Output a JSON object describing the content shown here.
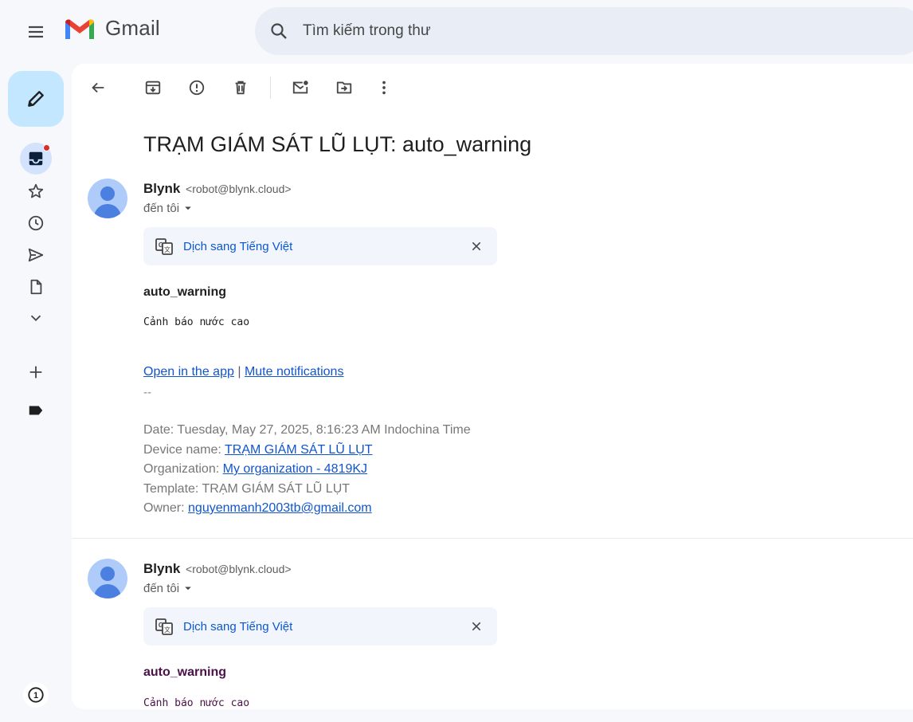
{
  "app": {
    "name": "Gmail"
  },
  "search": {
    "placeholder": "Tìm kiếm trong thư"
  },
  "toolbar": {
    "back": "arrow-back-icon",
    "archive": "archive-icon",
    "spam": "report-spam-icon",
    "delete": "delete-icon",
    "mark_unread": "mark-unread-icon",
    "move": "move-to-icon",
    "more": "more-vert-icon"
  },
  "subject": "TRẠM GIÁM SÁT LŨ LỤT: auto_warning",
  "colors": {
    "accent": "#0b57d0",
    "compose_bg": "#c2e7ff",
    "unread_dot": "#d93025",
    "link": "#1155cc",
    "visited": "#4a1248"
  },
  "messages": [
    {
      "sender_name": "Blynk",
      "sender_email": "<robot@blynk.cloud>",
      "to": "đến tôi",
      "translate_label": "Dịch sang Tiếng Việt",
      "title": "auto_warning",
      "body": "Cảnh báo nước cao",
      "link_open": "Open in the app",
      "link_sep": "|",
      "link_mute": "Mute notifications",
      "sig": "--",
      "date_label": "Date: Tuesday, May 27, 2025, 8:16:23 AM Indochina Time",
      "device_label": "Device name: ",
      "device_value": "TRẠM GIÁM SÁT LŨ LỤT",
      "org_label": "Organization: ",
      "org_value": "My organization - 4819KJ",
      "template_label": "Template: TRẠM GIÁM SÁT LŨ LỤT",
      "owner_label": "Owner: ",
      "owner_value": "nguyenmanh2003tb@gmail.com"
    },
    {
      "sender_name": "Blynk",
      "sender_email": "<robot@blynk.cloud>",
      "to": "đến tôi",
      "translate_label": "Dịch sang Tiếng Việt",
      "title": "auto_warning",
      "body": "Cảnh báo nước cao"
    }
  ],
  "badge": "1"
}
